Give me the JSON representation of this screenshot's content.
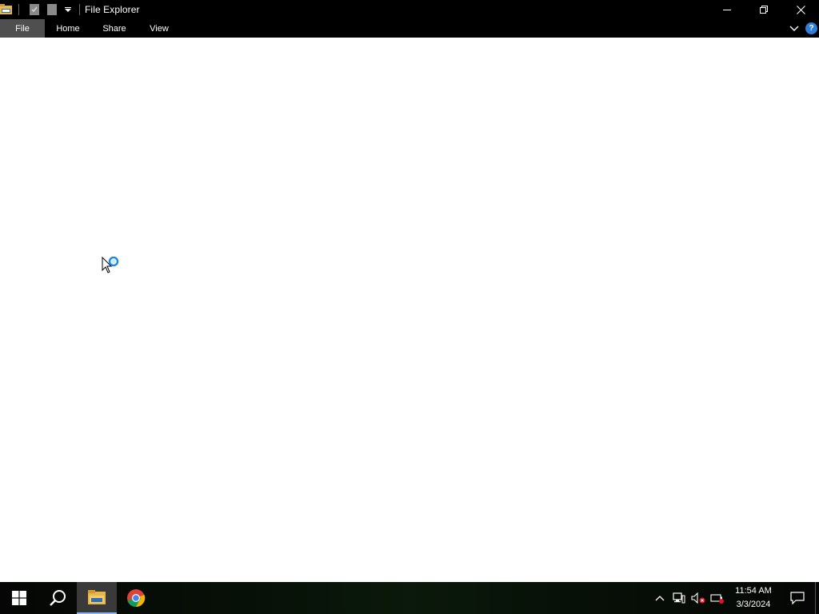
{
  "window": {
    "title": "File Explorer",
    "controls": [
      "minimize",
      "restore",
      "close"
    ]
  },
  "quick_access": {
    "icons": [
      "folder-icon",
      "properties-icon",
      "new-folder-icon",
      "customize-dropdown-icon"
    ]
  },
  "ribbon": {
    "tabs": [
      {
        "label": "File",
        "active": true
      },
      {
        "label": "Home",
        "active": false
      },
      {
        "label": "Share",
        "active": false
      },
      {
        "label": "View",
        "active": false
      }
    ],
    "help_label": "?"
  },
  "taskbar": {
    "pinned": [
      {
        "name": "start-button",
        "icon": "windows-logo-icon"
      },
      {
        "name": "search-button",
        "icon": "search-icon"
      },
      {
        "name": "file-explorer",
        "icon": "folder-icon",
        "active": true
      },
      {
        "name": "chrome",
        "icon": "chrome-icon"
      }
    ],
    "tray_icons": [
      "chevron-up-icon",
      "network-icon",
      "volume-muted-icon",
      "battery-icon"
    ],
    "time": "11:54 AM",
    "date": "3/3/2024"
  },
  "colors": {
    "accent": "#2f7fd8",
    "active_tab": "#4f4f4f",
    "content_bg": "#ffffff"
  }
}
